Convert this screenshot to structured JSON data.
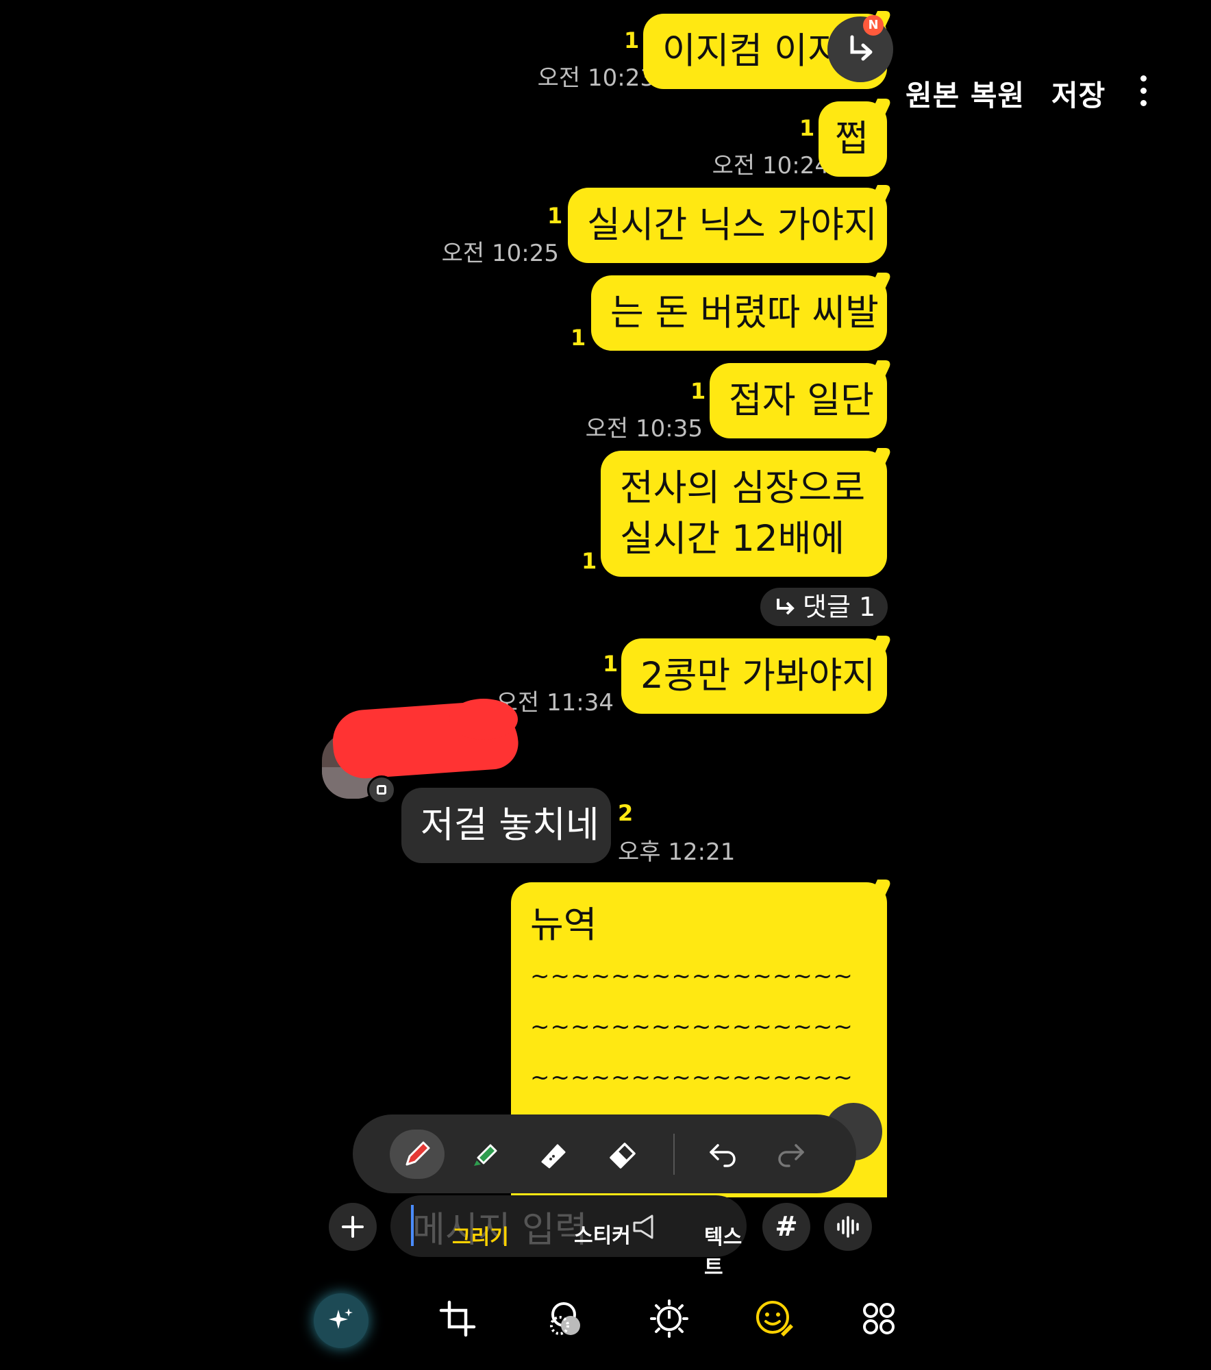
{
  "header": {
    "restore_label": "원본 복원",
    "save_label": "저장"
  },
  "messages": [
    {
      "text": "이지컴 이지",
      "time": "오전 10:23",
      "unread": "1"
    },
    {
      "text": "쩝",
      "time": "오전 10:24",
      "unread": "1"
    },
    {
      "text": "실시간 닉스 가야지",
      "time": "오전 10:25",
      "unread": "1"
    },
    {
      "text": "는 돈 버렸따 씨발",
      "time": "",
      "unread": "1"
    },
    {
      "text": "접자 일단",
      "time": "오전 10:35",
      "unread": "1"
    },
    {
      "line1": "전사의 심장으로",
      "line2": "실시간 12배에",
      "unread": "1"
    },
    {
      "text": "2콩만 가봐야지",
      "time": "오전 11:34",
      "unread": "1"
    },
    {
      "title": "뉴역",
      "lines": [
        "~~~~~~~~~~~~~~~~",
        "~~~~~~~~~~~~~~~~",
        "~~~~~~~~~~~~~~~~"
      ]
    }
  ],
  "reply_pill": {
    "label": "댓글 1"
  },
  "received": {
    "text": "저걸 놓치네",
    "time": "오후 12:21",
    "unread": "2"
  },
  "new_badge": "N",
  "input": {
    "placeholder": "메시지 입력"
  },
  "drawing_tabs": {
    "draw": "그리기",
    "sticker": "스티커",
    "text": "텍스트"
  },
  "hash_label": "#",
  "colors": {
    "bubble": "#ffe812",
    "accent": "#ffd200",
    "pen_red": "#e53935",
    "pen_green": "#2e9d4f"
  },
  "icons": [
    "redirect-icon",
    "pen-icon",
    "highlighter-icon",
    "tape-icon",
    "eraser-icon",
    "undo-icon",
    "redo-icon",
    "plus-icon",
    "voice-icon",
    "ai-sparkle-icon",
    "crop-icon",
    "filter-icon",
    "brightness-icon",
    "sticker-emoji-icon",
    "more-tools-icon"
  ]
}
